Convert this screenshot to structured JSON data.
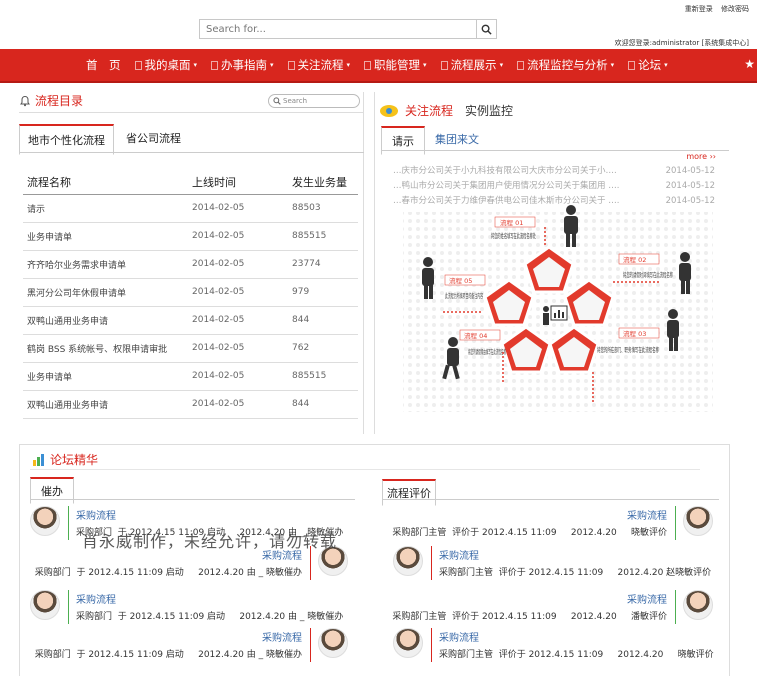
{
  "header": {
    "search_placeholder": "Search for...",
    "top_links": [
      "重新登录",
      "修改密码"
    ],
    "welcome": "欢迎您登录:administrator [系统集成中心]"
  },
  "nav": {
    "home": "首　页",
    "items": [
      "我的桌面",
      "办事指南",
      "关注流程",
      "职能管理",
      "流程展示",
      "流程监控与分析",
      "论坛"
    ]
  },
  "flow_catalog": {
    "title": "流程目录",
    "search_placeholder": "Search",
    "tabs": [
      "地市个性化流程",
      "省公司流程"
    ],
    "columns": [
      "流程名称",
      "上线时间",
      "发生业务量"
    ],
    "rows": [
      [
        "请示",
        "2014-02-05",
        "88503"
      ],
      [
        "业务申请单",
        "2014-02-05",
        "885515"
      ],
      [
        "齐齐哈尔业务需求申请单",
        "2014-02-05",
        "23774"
      ],
      [
        "黑河分公司年休假申请单",
        "2014-02-05",
        "979"
      ],
      [
        "双鸭山通用业务申请",
        "2014-02-05",
        "844"
      ],
      [
        "鹤岗 BSS 系统帐号、权限申请审批",
        "2014-02-05",
        "762"
      ],
      [
        "业务申请单",
        "2014-02-05",
        "885515"
      ],
      [
        "双鸭山通用业务申请",
        "2014-02-05",
        "844"
      ]
    ]
  },
  "focus": {
    "title": "关注流程",
    "title2": "实例监控",
    "tabs": [
      "请示",
      "集团来文"
    ],
    "more": "more ››",
    "news": [
      [
        "…庆市分公司关于小九科技有限公司大庆市分公司关于小….",
        "2014-05-12"
      ],
      [
        "…鸭山市分公司关于集团用户使用情况分公司关于集团用 ….",
        "2014-05-12"
      ],
      [
        "…春市分公司关于力维伊春供电公司佳木斯市分公司关于 ….",
        "2014-05-12"
      ]
    ],
    "diagram_labels": [
      {
        "tag": "流程 01",
        "text": "将您的姓名填写在此流程名称处"
      },
      {
        "tag": "流程 02",
        "text": "将您的请假时间填写在此流程名称"
      },
      {
        "tag": "流程 03",
        "text": "将您的所在部门、职务填写在此流程名称"
      },
      {
        "tag": "流程 04",
        "text": "将您的请假缘由填写在此流程名称"
      },
      {
        "tag": "流程 05",
        "text": "此流程为所填项目的备注内容"
      }
    ]
  },
  "forum": {
    "title": "论坛精华",
    "left_tab": "催办",
    "right_tab": "流程评价",
    "watermark": "肖永威制作，未经允许，请勿转载",
    "left_cards": [
      {
        "title": "采购流程",
        "detail": "采购部门  于 2012.4.15 11:09 启动     2012.4.20 由 _ 晓敏催办"
      },
      {
        "title": "采购流程",
        "detail": "采购部门  于 2012.4.15 11:09 启动     2012.4.20 由 _ 晓敏催办"
      },
      {
        "title": "采购流程",
        "detail": "采购部门  于 2012.4.15 11:09 启动     2012.4.20 由 _ 晓敏催办"
      },
      {
        "title": "采购流程",
        "detail": "采购部门  于 2012.4.15 11:09 启动     2012.4.20 由 _ 晓敏催办"
      }
    ],
    "right_cards": [
      {
        "title": "采购流程",
        "detail": "采购部门主管  评价于 2012.4.15 11:09     2012.4.20     晓敏评价"
      },
      {
        "title": "采购流程",
        "detail": "采购部门主管  评价于 2012.4.15 11:09     2012.4.20 赵晓敏评价"
      },
      {
        "title": "采购流程",
        "detail": "采购部门主管  评价于 2012.4.15 11:09     2012.4.20     潘敏评价"
      },
      {
        "title": "采购流程",
        "detail": "采购部门主管  评价于 2012.4.15 11:09     2012.4.20     晓敏评价"
      }
    ]
  },
  "colors": {
    "brand_red": "#d8261e",
    "link_blue": "#3a6aa8",
    "green_bar": "#4caf50"
  }
}
